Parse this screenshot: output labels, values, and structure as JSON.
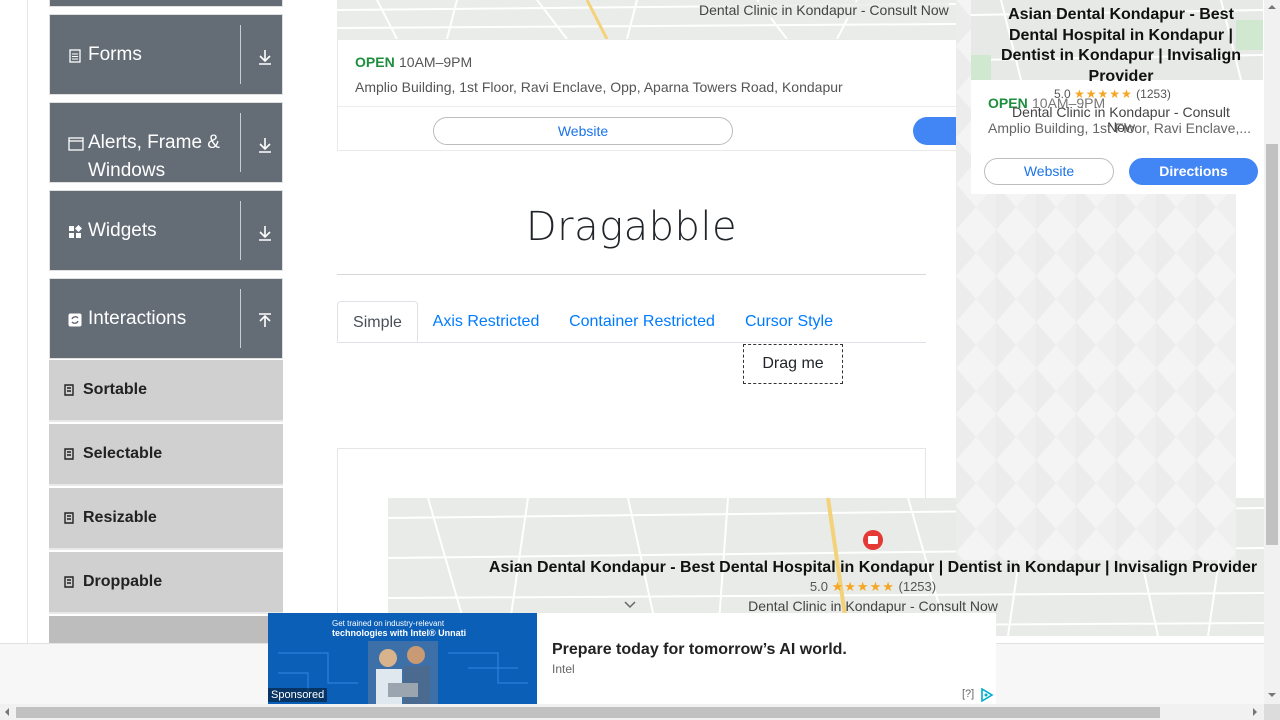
{
  "sidebar": {
    "groups": [
      {
        "label": "Forms",
        "icon": "document-icon"
      },
      {
        "label": "Alerts, Frame &",
        "label2": "Windows",
        "icon": "window-icon"
      },
      {
        "label": "Widgets",
        "icon": "widgets-icon"
      },
      {
        "label": "Interactions",
        "icon": "interactions-icon"
      }
    ],
    "items": [
      {
        "label": "Sortable"
      },
      {
        "label": "Selectable"
      },
      {
        "label": "Resizable"
      },
      {
        "label": "Droppable"
      }
    ]
  },
  "map_top": {
    "caption": "Dental Clinic in Kondapur - Consult Now",
    "status": "OPEN",
    "hours": "10AM–9PM",
    "address": "Amplio Building, 1st Floor, Ravi Enclave, Opp, Aparna Towers Road, Kondapur",
    "website_label": "Website"
  },
  "main": {
    "title": "Dragabble",
    "tabs": [
      "Simple",
      "Axis Restricted",
      "Container Restricted",
      "Cursor Style"
    ],
    "active_tab": "Simple",
    "drag_label": "Drag me"
  },
  "lower_map": {
    "title": "Asian Dental Kondapur - Best Dental Hospital in Kondapur | Dentist in Kondapur | Invisalign Provider",
    "rating": "5.0",
    "stars": "★★★★★",
    "reviews": "(1253)",
    "caption": "Dental Clinic in Kondapur - Consult Now"
  },
  "right_ad": {
    "title": "Asian Dental Kondapur - Best Dental Hospital in Kondapur | Dentist in Kondapur | Invisalign Provider",
    "rating": "5.0",
    "stars": "★★★★★",
    "reviews": "(1253)",
    "caption": "Dental Clinic in Kondapur - Consult Now",
    "status": "OPEN",
    "hours": "10AM–9PM",
    "address": "Amplio Building, 1st Floor, Ravi Enclave,...",
    "website_label": "Website",
    "directions_label": "Directions"
  },
  "bottom_ad": {
    "image_line1": "Get trained on industry-relevant",
    "image_line2": "technologies with Intel® Unnati",
    "sponsored": "Sponsored",
    "headline": "Prepare today for tomorrow’s AI world.",
    "advertiser": "Intel",
    "info_label": "[?]"
  },
  "colors": {
    "sidebar_group": "#646c76",
    "sidebar_item": "#d0d0d0",
    "link_blue": "#007bff",
    "open_green": "#1e8e3e",
    "button_blue": "#4285f4"
  }
}
